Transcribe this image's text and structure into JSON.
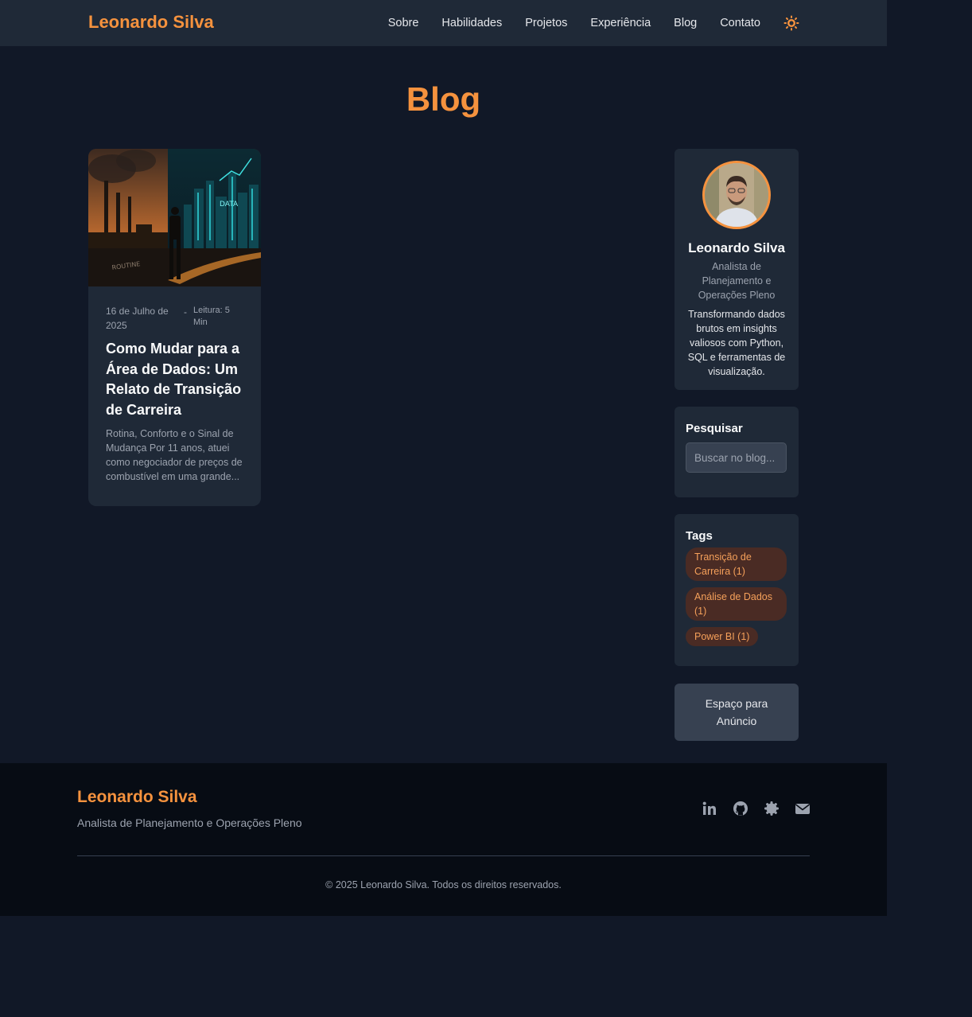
{
  "header": {
    "brand": "Leonardo Silva",
    "nav": [
      "Sobre",
      "Habilidades",
      "Projetos",
      "Experiência",
      "Blog",
      "Contato"
    ],
    "theme_icon": "sun-icon",
    "accent_color": "#f5923e"
  },
  "page_title": "Blog",
  "post": {
    "date": "16 de Julho de 2025",
    "separator": "-",
    "read_time": "Leitura: 5 Min",
    "title": "Como Mudar para a Área de Dados: Um Relato de Transição de Carreira",
    "excerpt": "Rotina, Conforto e o Sinal de Mudança Por 11 anos, atuei como negociador de preços de combustível em uma grande...",
    "image_text_data": "DATA",
    "image_text_routine": "ROUTINE"
  },
  "sidebar": {
    "profile": {
      "name": "Leonardo Silva",
      "role": "Analista de Planejamento e Operações Pleno",
      "bio": "Transformando dados brutos em insights valiosos com Python, SQL e ferramentas de visualização."
    },
    "search": {
      "title": "Pesquisar",
      "placeholder": "Buscar no blog..."
    },
    "tags": {
      "title": "Tags",
      "items": [
        "Transição de Carreira (1)",
        "Análise de Dados (1)",
        "Power BI (1)"
      ]
    },
    "ad": "Espaço para Anúncio"
  },
  "footer": {
    "name": "Leonardo Silva",
    "role": "Analista de Planejamento e Operações Pleno",
    "socials": [
      "linkedin-icon",
      "github-icon",
      "badge-icon",
      "envelope-icon"
    ],
    "copyright": "© 2025 Leonardo Silva. Todos os direitos reservados."
  }
}
